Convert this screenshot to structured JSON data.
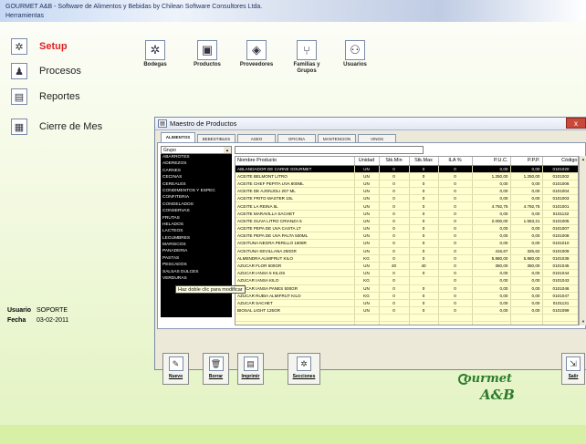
{
  "window_title": "GOURMET A&B - Software de Alimentos y Bebidas by Chilean Software Consultores Ltda.",
  "menu": {
    "herramientas": "Herramientas"
  },
  "sidebar": [
    {
      "label": "Setup",
      "icon": "gear-icon",
      "active": true
    },
    {
      "label": "Procesos",
      "icon": "worker-icon",
      "active": false
    },
    {
      "label": "Reportes",
      "icon": "report-icon",
      "active": false
    },
    {
      "label": "Cierre de Mes",
      "icon": "calendar-icon",
      "active": false
    }
  ],
  "toolbar": [
    {
      "label": "Bodegas",
      "icon": "warehouse-icon"
    },
    {
      "label": "Productos",
      "icon": "products-icon"
    },
    {
      "label": "Proveedores",
      "icon": "suppliers-icon"
    },
    {
      "label": "Familias y Grupos",
      "icon": "families-icon"
    },
    {
      "label": "Usuarios",
      "icon": "users-icon"
    }
  ],
  "user_info": {
    "usuario_label": "Usuario",
    "usuario": "SOPORTE",
    "fecha_label": "Fecha",
    "fecha": "03-02-2011"
  },
  "logo": {
    "line1": "ourmet",
    "line2": "A&B"
  },
  "window": {
    "title": "Maestro de Productos",
    "close": "x",
    "tabs": [
      "ALIMENTOS",
      "BEBESTIBLES",
      "ASEO",
      "OFICINA",
      "MANTENCION",
      "VINOS"
    ],
    "active_tab": "ALIMENTOS",
    "group_selected": "Grupo",
    "groups": [
      "ABARROTES",
      "ADEREZOS",
      "CARNES",
      "CECINAS",
      "CEREALES",
      "CONDIMENTOS Y ESPEC",
      "CONFITERIA",
      "CONGELADOS",
      "CONSERVAS",
      "FRUTAS",
      "HELADOS",
      "LACTEOS",
      "LEGUMBRES",
      "MARISCOS",
      "PANADERIA",
      "PASTAS",
      "PESCADOS",
      "SALSAS DULCES",
      "VERDURAS"
    ],
    "filter_value": "",
    "columns": [
      "Nombre Producto",
      "Unidad",
      "Stk.Min",
      "Stk.Max",
      "ILA %",
      "P.U.C.",
      "P.P.P.",
      "Código"
    ],
    "rows": [
      [
        "ABLANDADOR DE CARNE GOURMET",
        "UN",
        "0",
        "0",
        "0",
        "0,00",
        "0,00",
        "0101020"
      ],
      [
        "ACEITE BELMONT LITRO",
        "UN",
        "0",
        "0",
        "0",
        "1.250,00",
        "1.250,00",
        "0101002"
      ],
      [
        "ACEITE CHEF PEPITA UVA 800ML",
        "UN",
        "0",
        "0",
        "0",
        "0,00",
        "0,00",
        "0101006"
      ],
      [
        "ACEITE DE AJONJOLI 207 ML",
        "UN",
        "0",
        "0",
        "0",
        "0,00",
        "0,00",
        "0101004"
      ],
      [
        "ACEITE FRITO MASTER 10L",
        "UN",
        "0",
        "0",
        "0",
        "0,00",
        "0,00",
        "0101003"
      ],
      [
        "ACEITE LA REINA 5L",
        "UN",
        "0",
        "0",
        "0",
        "4.792,75",
        "4.792,75",
        "0101001"
      ],
      [
        "ACEITE MARAVILLA SACHET",
        "UN",
        "0",
        "0",
        "0",
        "0,00",
        "0,00",
        "0101132"
      ],
      [
        "ACEITE OLIVA LITRO CRIANZA 5",
        "UN",
        "0",
        "0",
        "0",
        "2.000,00",
        "1.553,21",
        "0101005"
      ],
      [
        "ACEITE PEPA DE UVA CASTA LT",
        "UN",
        "0",
        "0",
        "0",
        "0,00",
        "0,00",
        "0101007"
      ],
      [
        "ACEITE PEPA DE UVA PALTA 500ML",
        "UN",
        "0",
        "0",
        "0",
        "0,00",
        "0,00",
        "0101008"
      ],
      [
        "ACEITUNA NEGRA PERILLO 1608R",
        "UN",
        "0",
        "0",
        "0",
        "0,00",
        "0,00",
        "0101010"
      ],
      [
        "ACEITUNA SEVILLANA 250GR",
        "UN",
        "0",
        "0",
        "0",
        "416,67",
        "325,62",
        "0101009"
      ],
      [
        "ALMENDRA ALMIFRUT KILO",
        "KG",
        "0",
        "0",
        "0",
        "5.880,00",
        "5.880,00",
        "0101036"
      ],
      [
        "AZUCAR FLOR 500GR",
        "UN",
        "20",
        "40",
        "0",
        "350,00",
        "350,00",
        "0101045"
      ],
      [
        "AZUCAR IANSA 5 KILOS",
        "UN",
        "0",
        "0",
        "0",
        "0,00",
        "0,00",
        "0101044"
      ],
      [
        "AZUCAR IANSA KILO",
        "KG",
        "0",
        "",
        "0",
        "0,00",
        "0,00",
        "0101043"
      ],
      [
        "AZUCAR IANSA PANES 500GR",
        "UN",
        "0",
        "0",
        "0",
        "0,00",
        "0,00",
        "0101046"
      ],
      [
        "AZUCAR RUBIA ALMIFRUT KILO",
        "KG",
        "0",
        "0",
        "0",
        "0,00",
        "0,00",
        "0101047"
      ],
      [
        "AZUCAR SACHET",
        "UN",
        "0",
        "0",
        "0",
        "0,00",
        "0,00",
        "0101131"
      ],
      [
        "BIOSAL LIGHT 125GR",
        "UN",
        "0",
        "0",
        "0",
        "0,00",
        "0,00",
        "0101099"
      ],
      [
        "",
        "",
        "",
        "",
        "",
        "",
        "",
        ""
      ],
      [
        "",
        "",
        "",
        "",
        "",
        "",
        "",
        ""
      ]
    ],
    "tooltip": "Haz doble clic para modificar",
    "buttons": [
      {
        "label": "Nuevo",
        "icon": "new-icon"
      },
      {
        "label": "Borrar",
        "icon": "trash-icon"
      },
      {
        "label": "Imprimir",
        "icon": "print-icon"
      },
      {
        "label": "Secciones",
        "icon": "sections-icon"
      },
      {
        "label": "Salir",
        "icon": "exit-icon"
      }
    ]
  }
}
